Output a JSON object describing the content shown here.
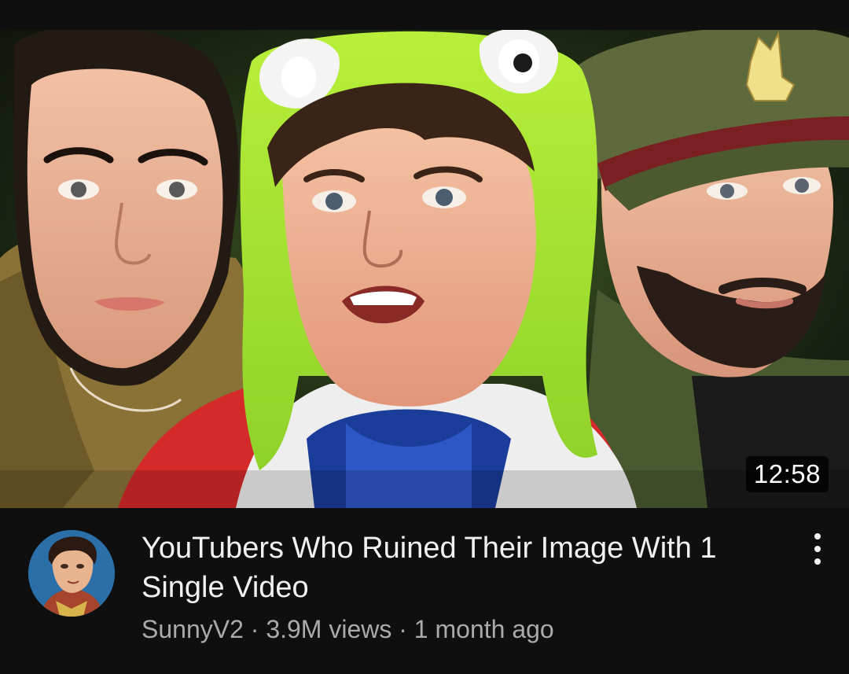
{
  "video": {
    "duration": "12:58",
    "title": "YouTubers Who Ruined Their Image With 1 Single Video",
    "channel": "SunnyV2",
    "separator": "·",
    "views": "3.9M views",
    "age": "1 month ago"
  },
  "icons": {
    "menu": "more-vertical-icon",
    "avatar": "channel-avatar"
  },
  "colors": {
    "background": "#0f0f0f",
    "title_text": "#f1f1f1",
    "meta_text": "#aaaaaa",
    "frog_hat_green": "#a6e22e",
    "avatar_ring": "#2a6fa8"
  }
}
